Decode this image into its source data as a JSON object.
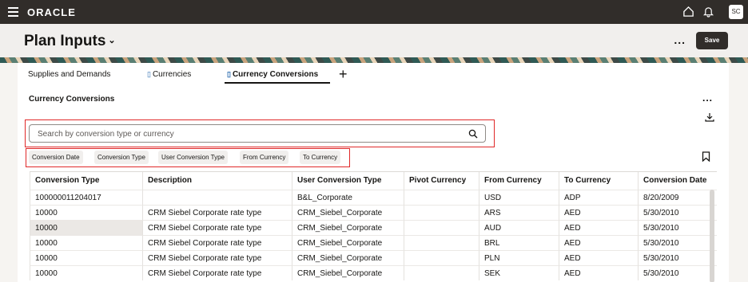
{
  "topbar": {
    "brand": "ORACLE",
    "avatar_initials": "SC",
    "icons": [
      "menu-icon",
      "home-icon",
      "bell-icon"
    ]
  },
  "header": {
    "title": "Plan Inputs",
    "chevron": "⌄",
    "more": "...",
    "save_label": "Save"
  },
  "tabs": [
    {
      "label": "Supplies and Demands",
      "has_doc_icon": false,
      "active": false
    },
    {
      "label": "Currencies",
      "has_doc_icon": true,
      "active": false
    },
    {
      "label": "Currency Conversions",
      "has_doc_icon": true,
      "active": true
    }
  ],
  "tab_add": "+",
  "section": {
    "title": "Currency Conversions",
    "more": "..."
  },
  "search": {
    "placeholder": "Search by conversion type or currency",
    "value": ""
  },
  "filter_chips": [
    "Conversion Date",
    "Conversion Type",
    "User Conversion Type",
    "From Currency",
    "To Currency"
  ],
  "table": {
    "columns": [
      "Conversion Type",
      "Description",
      "User Conversion Type",
      "Pivot Currency",
      "From Currency",
      "To Currency",
      "Conversion Date"
    ],
    "rows": [
      [
        "100000011204017",
        "",
        "B&L_Corporate",
        "",
        "USD",
        "ADP",
        "8/20/2009"
      ],
      [
        "10000",
        "CRM Siebel Corporate rate type",
        "CRM_Siebel_Corporate",
        "",
        "ARS",
        "AED",
        "5/30/2010"
      ],
      [
        "10000",
        "CRM Siebel Corporate rate type",
        "CRM_Siebel_Corporate",
        "",
        "AUD",
        "AED",
        "5/30/2010"
      ],
      [
        "10000",
        "CRM Siebel Corporate rate type",
        "CRM_Siebel_Corporate",
        "",
        "BRL",
        "AED",
        "5/30/2010"
      ],
      [
        "10000",
        "CRM Siebel Corporate rate type",
        "CRM_Siebel_Corporate",
        "",
        "PLN",
        "AED",
        "5/30/2010"
      ],
      [
        "10000",
        "CRM Siebel Corporate rate type",
        "CRM_Siebel_Corporate",
        "",
        "SEK",
        "AED",
        "5/30/2010"
      ]
    ]
  },
  "colors": {
    "topbar": "#312d2a",
    "highlight_outline": "#e02828",
    "save_button": "#312d2a"
  }
}
